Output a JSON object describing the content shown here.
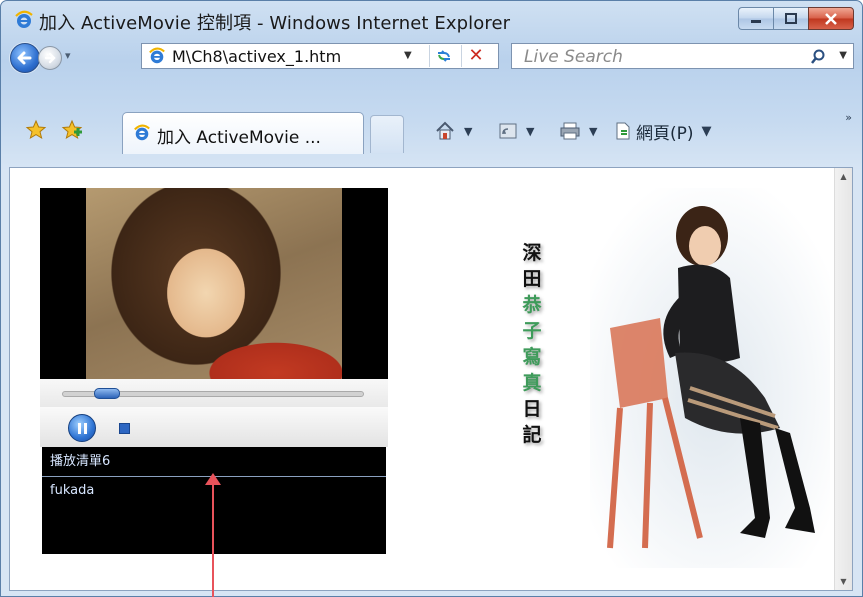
{
  "window": {
    "title": "加入 ActiveMovie 控制項 - Windows Internet Explorer",
    "controls": {
      "minimize": "minimize",
      "maximize": "maximize",
      "close": "close"
    }
  },
  "address_bar": {
    "url": "M\\Ch8\\activex_1.htm",
    "search_placeholder": "Live Search"
  },
  "tabs": [
    {
      "label": "加入 ActiveMovie ..."
    }
  ],
  "command_bar": {
    "page_menu": "網頁(P)"
  },
  "content": {
    "playlist_title": "播放清單6",
    "playlist_item": "fukada",
    "vertical_text": [
      "深",
      "田",
      "恭",
      "子",
      "寫",
      "真",
      "日",
      "記"
    ],
    "seek_progress": 0.12
  },
  "colors": {
    "accent_blue": "#2f74d3",
    "close_red": "#c0381f",
    "annotation_arrow": "#e8535b",
    "title_green": "#3e9b5a"
  }
}
